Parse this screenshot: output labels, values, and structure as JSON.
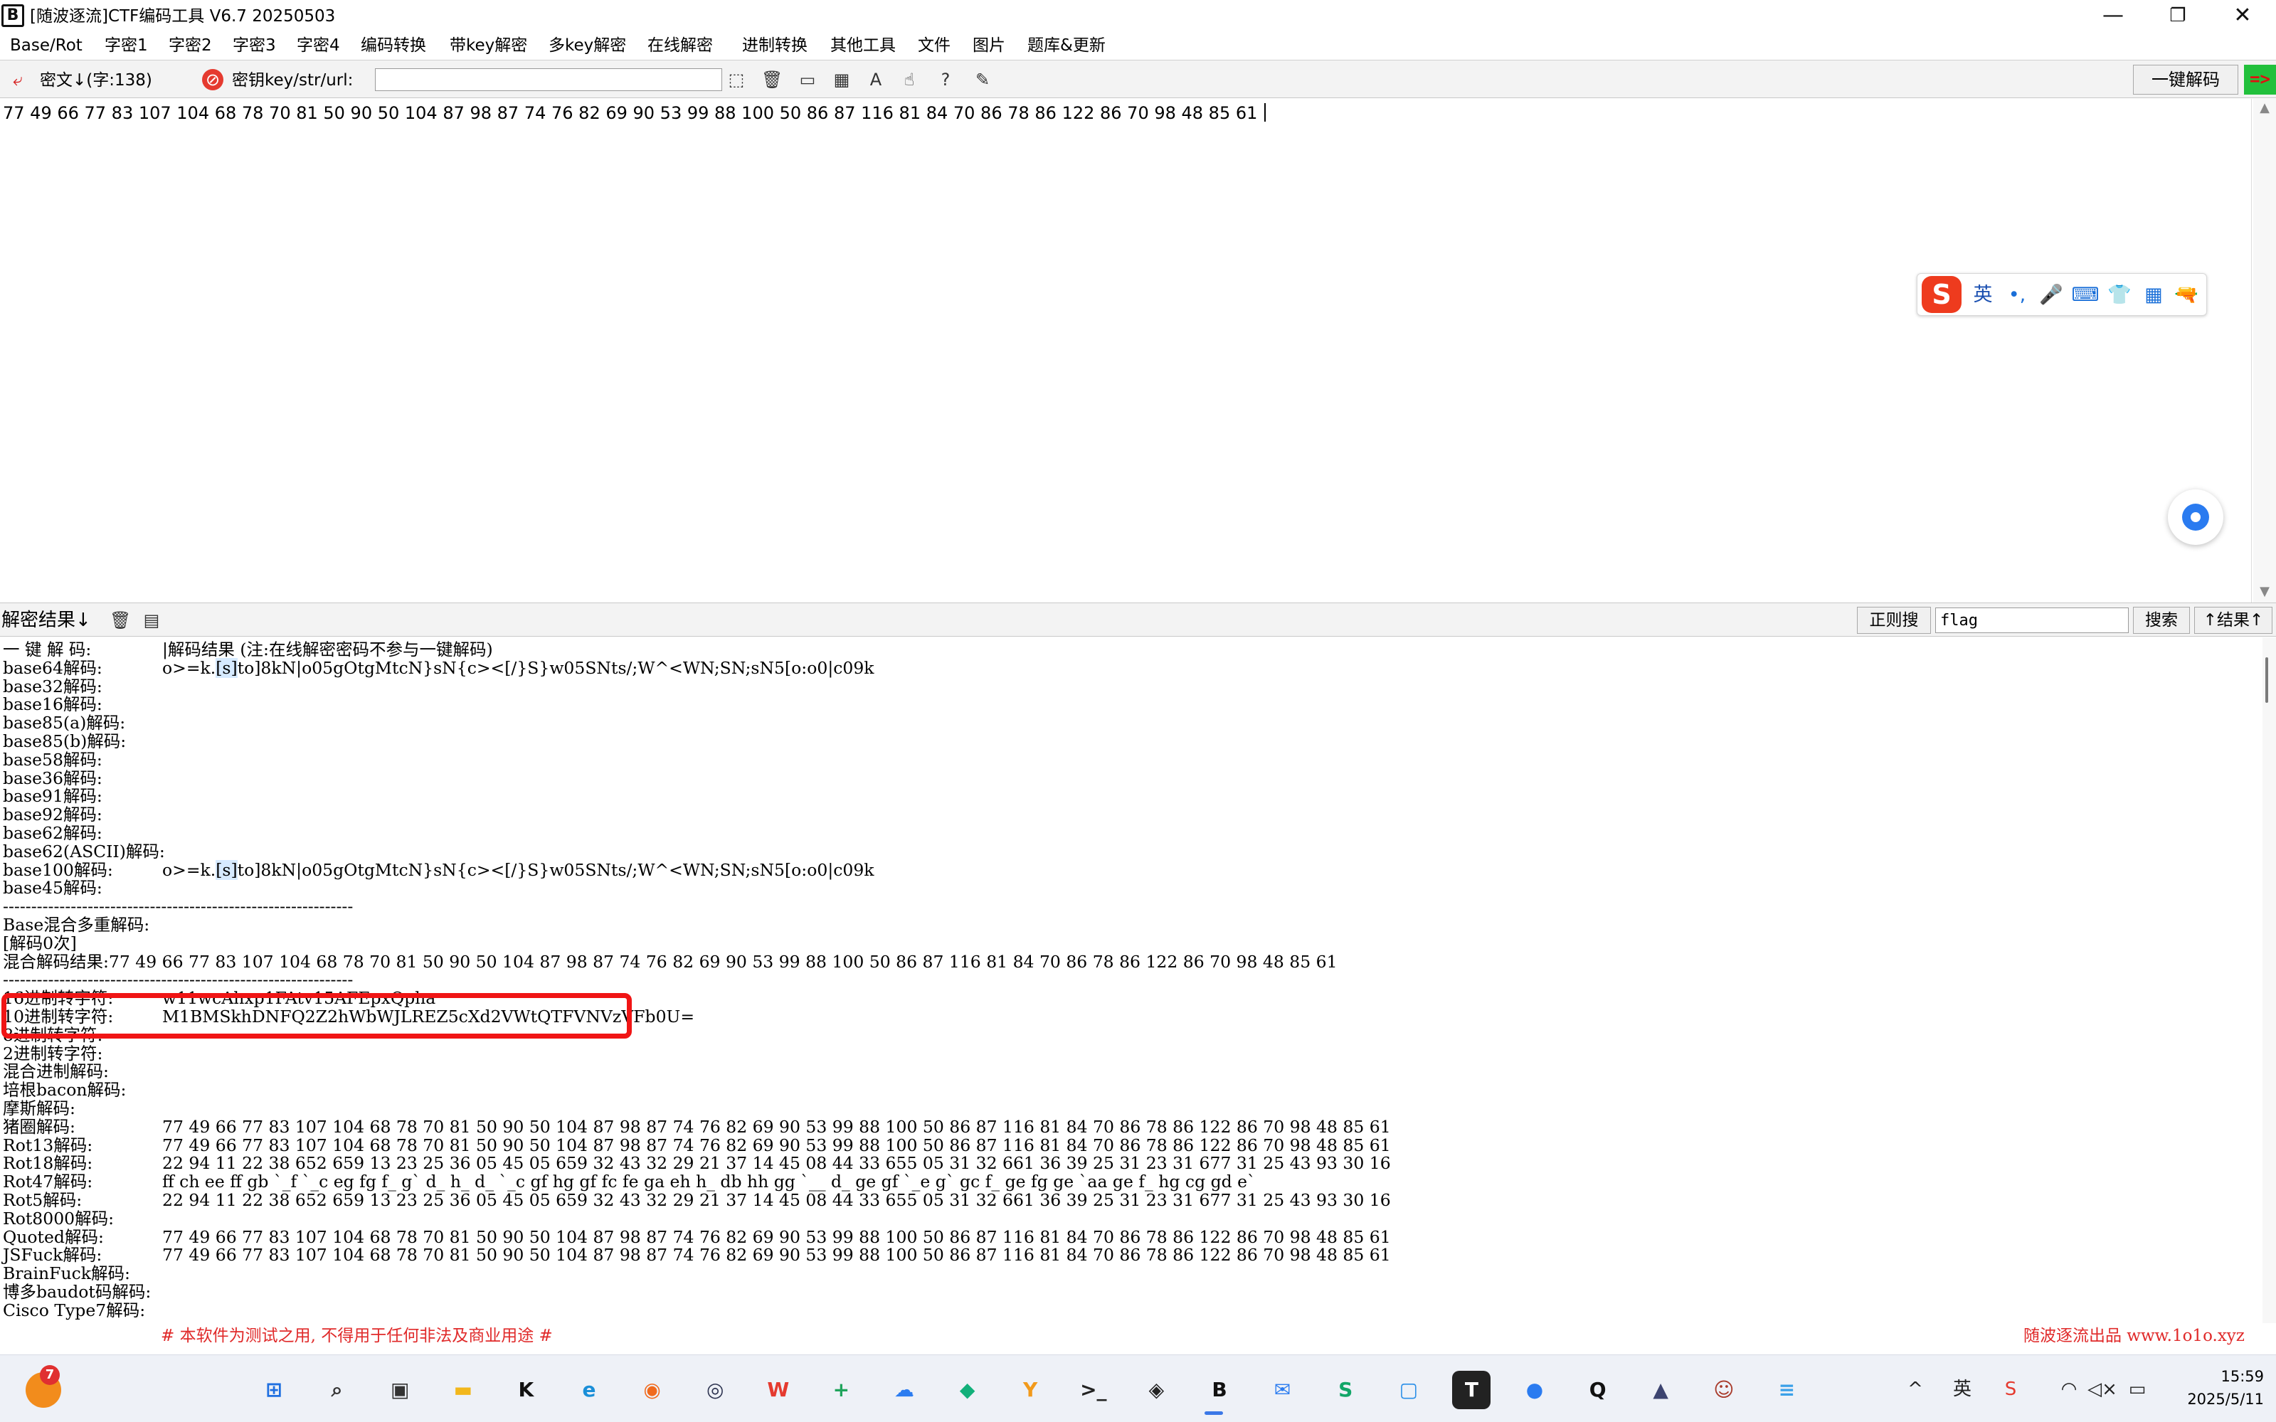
{
  "window": {
    "title": "[随波逐流]CTF编码工具 V6.7  20250503",
    "app_icon_glyph": "B",
    "minimize": "—",
    "maximize": "❐",
    "close": "✕"
  },
  "menu": [
    "Base/Rot",
    "字密1",
    "字密2",
    "字密3",
    "字密4",
    "编码转换",
    "带key解密",
    "多key解密",
    "在线解密",
    "进制转换",
    "其他工具",
    "文件",
    "图片",
    "题库&更新"
  ],
  "toolbar": {
    "cipher_label": "密文↓(字:138)",
    "key_label": "密钥key/str/url:",
    "key_value": "",
    "one_click_label": "一键解码",
    "run_arrow": "=>"
  },
  "cipher_text": "77 49 66 77 83 107 104 68 78 70 81 50 90 50 104 87 98 87 74 76 82 69 90 53 99 88 100 50 86 87 116 81 84 70 86 78 86 122 86 70 98 48 85 61",
  "ime": {
    "logo": "S",
    "lang": "英",
    "items": [
      "•,",
      "🎤",
      "⌨",
      "👕",
      "▦",
      "🔫"
    ]
  },
  "result_bar": {
    "label": "解密结果↓",
    "regex_button": "正则搜",
    "search_value": "flag",
    "search_button": "搜索",
    "result_up_button": "↑结果↑"
  },
  "results": [
    {
      "label": "一 键 解 码:",
      "value": "|解码结果 (注:在线解密密码不参与一键解码)"
    },
    {
      "label": "base64解码:",
      "value_pre": "o>=k.",
      "value_hl": "[s]",
      "value_post": "to]8kN|o05gOtgMtcN}sN{c><[/}S}w05SNts/;W^<WN;SN;sN5[o:o0|c09k"
    },
    {
      "label": "base32解码:",
      "value": ""
    },
    {
      "label": "base16解码:",
      "value": ""
    },
    {
      "label": "base85(a)解码:",
      "value": ""
    },
    {
      "label": "base85(b)解码:",
      "value": ""
    },
    {
      "label": "base58解码:",
      "value": ""
    },
    {
      "label": "base36解码:",
      "value": ""
    },
    {
      "label": "base91解码:",
      "value": ""
    },
    {
      "label": "base92解码:",
      "value": ""
    },
    {
      "label": "base62解码:",
      "value": ""
    },
    {
      "label": "base62(ASCII)解码:",
      "value": ""
    },
    {
      "label": "base100解码:",
      "value_pre": "o>=k.",
      "value_hl": "[s]",
      "value_post": "to]8kN|o05gOtgMtcN}sN{c><[/}S}w05SNts/;W^<WN;SN;sN5[o:o0|c09k"
    },
    {
      "label": "base45解码:",
      "value": ""
    },
    {
      "label": "--------------------------------------------------------------",
      "value": ""
    },
    {
      "label": "Base混合多重解码:",
      "value": ""
    },
    {
      "label": "[解码0次]",
      "value": ""
    },
    {
      "label": "混合解码结果:77 49 66 77 83 107 104 68 78 70 81 50 90 50 104 87 98 87 74 76 82 69 90 53 99 88 100 50 86 87 116 81 84 70 86 78 86 122 86 70 98 48 85 61",
      "value": ""
    },
    {
      "label": "--------------------------------------------------------------",
      "value": ""
    },
    {
      "label": "16进制转字符:",
      "value": "w11wcAhxp1FAtv15AFEpxQpha"
    },
    {
      "label": "10进制转字符:",
      "value": "M1BMSkhDNFQ2Z2hWbWJLREZ5cXd2VWtQTFVNVzVFb0U="
    },
    {
      "label": "8进制转字符:",
      "value": ""
    },
    {
      "label": "2进制转字符:",
      "value": ""
    },
    {
      "label": "混合进制解码:",
      "value": ""
    },
    {
      "label": "培根bacon解码:",
      "value": ""
    },
    {
      "label": "摩斯解码:",
      "value": ""
    },
    {
      "label": "猪圈解码:",
      "value": "77 49 66 77 83 107 104 68 78 70 81 50 90 50 104 87 98 87 74 76 82 69 90 53 99 88 100 50 86 87 116 81 84 70 86 78 86 122 86 70 98 48 85 61"
    },
    {
      "label": "Rot13解码:",
      "value": "77 49 66 77 83 107 104 68 78 70 81 50 90 50 104 87 98 87 74 76 82 69 90 53 99 88 100 50 86 87 116 81 84 70 86 78 86 122 86 70 98 48 85 61"
    },
    {
      "label": "Rot18解码:",
      "value": "22 94 11 22 38 652 659 13 23 25 36 05 45 05 659 32 43 32 29 21 37 14 45 08 44 33 655 05 31 32 661 36 39 25 31 23 31 677 31 25 43 93 30 16"
    },
    {
      "label": "Rot47解码:",
      "value": "ff ch ee ff gb `_f `_c eg fg f_ g` d_ h_ d_ `_c gf hg gf fc fe ga eh h_ db hh gg `__ d_ ge gf `_e g` gc f_ ge fg ge `aa ge f_ hg cg gd e`"
    },
    {
      "label": "Rot5解码:",
      "value": "22 94 11 22 38 652 659 13 23 25 36 05 45 05 659 32 43 32 29 21 37 14 45 08 44 33 655 05 31 32 661 36 39 25 31 23 31 677 31 25 43 93 30 16"
    },
    {
      "label": "Rot8000解码:",
      "value": ""
    },
    {
      "label": "Quoted解码:",
      "value": "77 49 66 77 83 107 104 68 78 70 81 50 90 50 104 87 98 87 74 76 82 69 90 53 99 88 100 50 86 87 116 81 84 70 86 78 86 122 86 70 98 48 85 61"
    },
    {
      "label": "JSFuck解码:",
      "value": "77 49 66 77 83 107 104 68 78 70 81 50 90 50 104 87 98 87 74 76 82 69 90 53 99 88 100 50 86 87 116 81 84 70 86 78 86 122 86 70 98 48 85 61"
    },
    {
      "label": "BrainFuck解码:",
      "value": ""
    },
    {
      "label": "博多baudot码解码:",
      "value": ""
    },
    {
      "label": "Cisco Type7解码:",
      "value": ""
    }
  ],
  "footer": {
    "notice": "# 本软件为测试之用, 不得用于任何非法及商业用途 #",
    "brand": "随波逐流出品 www.1o1o.xyz"
  },
  "taskbar": {
    "weather_badge": "7",
    "apps": [
      {
        "name": "start",
        "glyph": "⊞",
        "color": "#1f6fe0"
      },
      {
        "name": "search",
        "glyph": "⌕",
        "color": "#333333"
      },
      {
        "name": "task-view",
        "glyph": "▣",
        "color": "#333333"
      },
      {
        "name": "file-explorer",
        "glyph": "▬",
        "color": "#f2b71c"
      },
      {
        "name": "app-k",
        "glyph": "K",
        "color": "#111111"
      },
      {
        "name": "edge",
        "glyph": "e",
        "color": "#1a8fd8"
      },
      {
        "name": "firefox",
        "glyph": "◉",
        "color": "#f06a1d"
      },
      {
        "name": "app-dark",
        "glyph": "◎",
        "color": "#2d3350"
      },
      {
        "name": "wps",
        "glyph": "W",
        "color": "#e53a2f"
      },
      {
        "name": "sheets",
        "glyph": "+",
        "color": "#1fa45c"
      },
      {
        "name": "cloud",
        "glyph": "☁",
        "color": "#2b7cf0"
      },
      {
        "name": "bag",
        "glyph": "◆",
        "color": "#12b07a"
      },
      {
        "name": "yonder",
        "glyph": "Y",
        "color": "#f29a1b"
      },
      {
        "name": "terminal",
        "glyph": ">_",
        "color": "#222222"
      },
      {
        "name": "box",
        "glyph": "◈",
        "color": "#222222"
      },
      {
        "name": "ctf-tool",
        "glyph": "B",
        "color": "#111111"
      },
      {
        "name": "mail",
        "glyph": "✉",
        "color": "#2b7cf0"
      },
      {
        "name": "app-s",
        "glyph": "S",
        "color": "#12a668"
      },
      {
        "name": "vm",
        "glyph": "▢",
        "color": "#2b8fe8"
      },
      {
        "name": "typora",
        "glyph": "T",
        "color": "#ffffff"
      },
      {
        "name": "chat",
        "glyph": "●",
        "color": "#2a7bf0"
      },
      {
        "name": "qq",
        "glyph": "Q",
        "color": "#111111"
      },
      {
        "name": "cat",
        "glyph": "▲",
        "color": "#3c4470"
      },
      {
        "name": "avatar",
        "glyph": "☺",
        "color": "#a83a2a"
      },
      {
        "name": "notepad",
        "glyph": "≡",
        "color": "#3aa0e8"
      }
    ],
    "tray_chevron": "^",
    "tray_ime": "英",
    "tray_sogou": "S",
    "tray_wifi": "◠",
    "tray_volume": "◁×",
    "tray_battery": "▭",
    "time": "15:59",
    "date": "2025/5/11"
  }
}
